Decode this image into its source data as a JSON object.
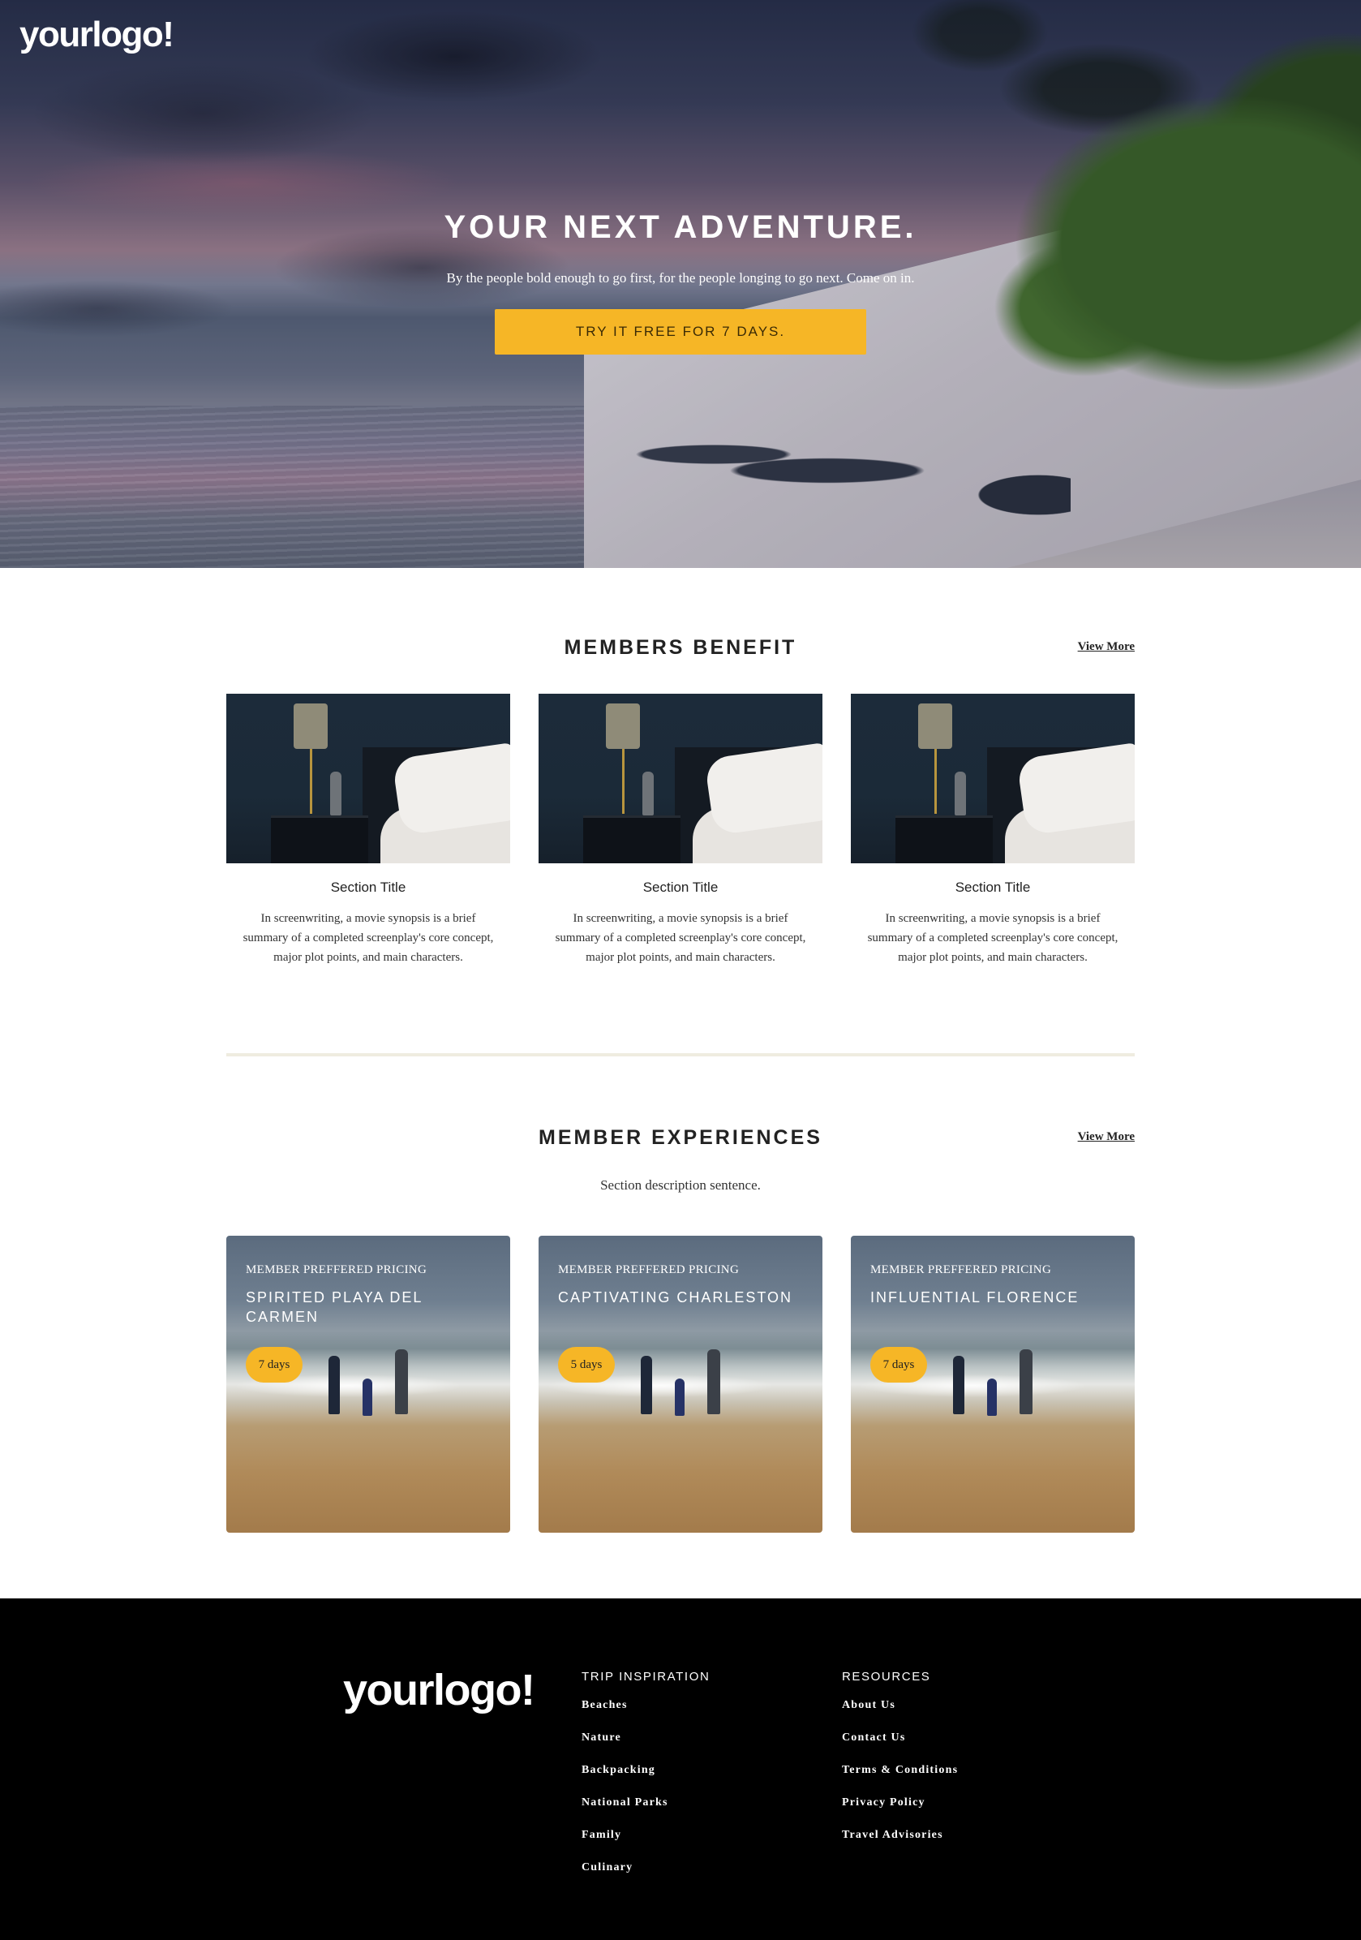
{
  "brand": {
    "logo_text": "yourlogo!",
    "accent_color": "#f6b626"
  },
  "hero": {
    "title": "YOUR NEXT ADVENTURE.",
    "subtitle": "By the people bold enough to go first, for the people longing to go next. Come on in.",
    "cta_label": "TRY IT FREE FOR 7 DAYS."
  },
  "benefits": {
    "title": "MEMBERS BENEFIT",
    "view_more": "View More",
    "cards": [
      {
        "title": "Section Title",
        "description": "In screenwriting, a movie synopsis is a brief summary of a completed screenplay's core concept, major plot points, and main characters."
      },
      {
        "title": "Section Title",
        "description": "In screenwriting, a movie synopsis is a brief summary of a completed screenplay's core concept, major plot points, and main characters."
      },
      {
        "title": "Section Title",
        "description": "In screenwriting, a movie synopsis is a brief summary of a completed screenplay's core concept, major plot points, and main characters."
      }
    ]
  },
  "experiences": {
    "title": "MEMBER EXPERIENCES",
    "view_more": "View More",
    "description": "Section description sentence.",
    "cards": [
      {
        "kicker": "MEMBER PREFFERED PRICING",
        "name": "SPIRITED PLAYA DEL CARMEN",
        "badge": "7 days"
      },
      {
        "kicker": "MEMBER PREFFERED PRICING",
        "name": "CAPTIVATING CHARLESTON",
        "badge": "5 days"
      },
      {
        "kicker": "MEMBER PREFFERED PRICING",
        "name": "INFLUENTIAL FLORENCE",
        "badge": "7 days"
      }
    ]
  },
  "footer": {
    "logo_text": "yourlogo!",
    "columns": [
      {
        "heading": "TRIP INSPIRATION",
        "links": [
          "Beaches",
          "Nature",
          "Backpacking",
          "National Parks",
          "Family",
          "Culinary"
        ]
      },
      {
        "heading": "RESOURCES",
        "links": [
          "About Us",
          "Contact Us",
          "Terms & Conditions",
          "Privacy Policy",
          "Travel Advisories"
        ]
      }
    ]
  }
}
